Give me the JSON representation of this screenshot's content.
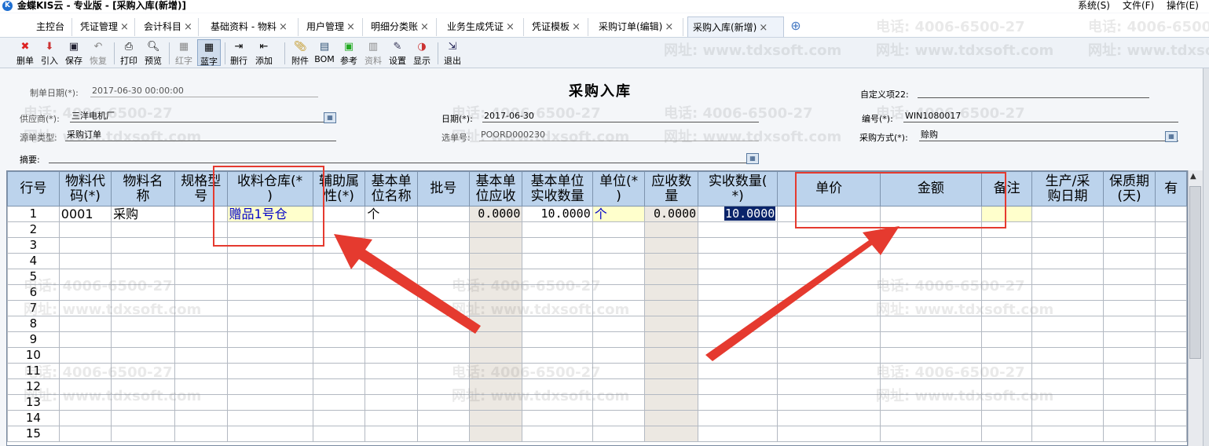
{
  "window": {
    "title": "金蝶KIS云 - 专业版 - [采购入库(新增)]",
    "menu": [
      "系统(S)",
      "文件(F)",
      "操作(E)"
    ]
  },
  "tabs": [
    {
      "label": "主控台",
      "closable": false
    },
    {
      "label": "凭证管理",
      "closable": true
    },
    {
      "label": "会计科目",
      "closable": true
    },
    {
      "label": "基础资料 - 物料",
      "closable": true
    },
    {
      "label": "用户管理",
      "closable": true
    },
    {
      "label": "明细分类账",
      "closable": true
    },
    {
      "label": "业务生成凭证",
      "closable": true
    },
    {
      "label": "凭证模板",
      "closable": true
    },
    {
      "label": "采购订单(编辑)",
      "closable": true
    },
    {
      "label": "采购入库(新增)",
      "closable": true,
      "active": true
    }
  ],
  "toolbar": {
    "delete_row": "删单",
    "import": "引入",
    "save": "保存",
    "restore": "恢复",
    "print": "打印",
    "preview": "预览",
    "red": "红字",
    "blue": "蓝字",
    "del_line": "删行",
    "add_line": "添加",
    "attach": "附件",
    "bom": "BOM",
    "reference": "参考",
    "material": "资料",
    "settings": "设置",
    "display": "显示",
    "exit": "退出"
  },
  "form": {
    "title": "采购入库",
    "create_date_label": "制单日期(*):",
    "create_date": "2017-06-30 00:00:00",
    "custom_label": "自定义项22:",
    "custom_value": "",
    "supplier_label": "供应商(*):",
    "supplier": "三洋电机厂",
    "date_label": "日期(*):",
    "date": "2017-06-30",
    "number_label": "编号(*):",
    "number": "WIN1080017",
    "source_type_label": "源单类型:",
    "source_type": "采购订单",
    "select_no_label": "选单号:",
    "select_no": "POORD000230",
    "purchase_mode_label": "采购方式(*):",
    "purchase_mode": "赊购",
    "summary_label": "摘要:",
    "summary": ""
  },
  "watermark": {
    "phone": "电话: 4006-6500-27",
    "site": "网址: www.tdxsoft.com"
  },
  "grid": {
    "headers": [
      [
        "行号"
      ],
      [
        "物料代",
        "码(*)"
      ],
      [
        "物料名",
        "称"
      ],
      [
        "规格型",
        "号"
      ],
      [
        "收料仓库(*",
        ")"
      ],
      [
        "辅助属",
        "性(*)"
      ],
      [
        "基本单",
        "位名称"
      ],
      [
        "批号"
      ],
      [
        "基本单",
        "位应收"
      ],
      [
        "基本单位",
        "实收数量"
      ],
      [
        "单位(*",
        ")"
      ],
      [
        "应收数",
        "量"
      ],
      [
        "实收数量(",
        "*)"
      ],
      [
        "单价"
      ],
      [
        "金额"
      ],
      [
        "备注"
      ],
      [
        "生产/采",
        "购日期"
      ],
      [
        "保质期",
        "(天)"
      ],
      [
        "有"
      ]
    ],
    "rows": [
      {
        "no": "1",
        "code": "0001",
        "name": "采购",
        "spec": "",
        "warehouse": "赠品1号仓",
        "aux": "",
        "base_unit": "个",
        "batch": "",
        "base_due": "0.0000",
        "base_qty": "10.0000",
        "unit": "个",
        "due_qty": "0.0000",
        "actual_qty": "10.0000",
        "price": "",
        "amount": "",
        "note": "",
        "prod_date": "",
        "shelf": "",
        "more": ""
      },
      {
        "no": "2"
      },
      {
        "no": "3"
      },
      {
        "no": "4"
      },
      {
        "no": "5"
      },
      {
        "no": "6"
      },
      {
        "no": "7"
      },
      {
        "no": "8"
      },
      {
        "no": "9"
      },
      {
        "no": "10"
      },
      {
        "no": "11"
      },
      {
        "no": "12"
      },
      {
        "no": "13"
      },
      {
        "no": "14"
      },
      {
        "no": "15"
      }
    ]
  },
  "colors": {
    "annotation": "#e53a2f",
    "header_bg": "#bcd3ec",
    "selection": "#0a246a"
  }
}
